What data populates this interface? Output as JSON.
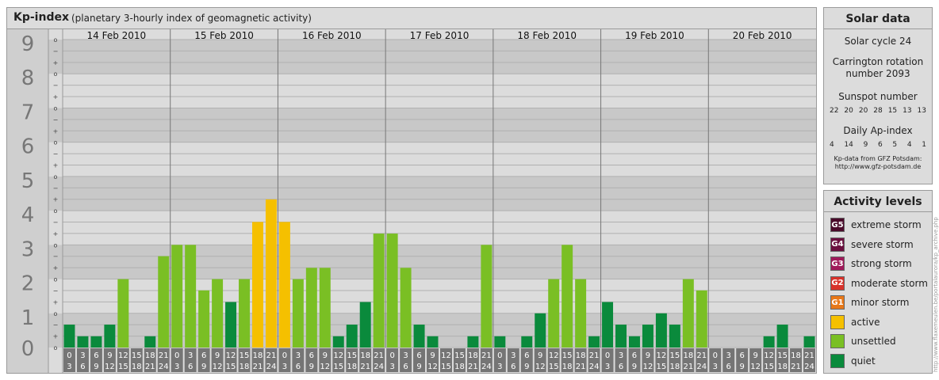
{
  "header": {
    "title": "Kp-index",
    "subtitle": "(planetary 3-hourly index of geomagnetic activity)"
  },
  "chart_data": {
    "type": "bar",
    "title": "Kp-index",
    "subtitle": "(planetary 3-hourly index of geomagnetic activity)",
    "ylim": [
      0,
      9
    ],
    "y_ticks": [
      "0",
      "1",
      "2",
      "3",
      "4",
      "5",
      "6",
      "7",
      "8",
      "9"
    ],
    "y_subticks": [
      "o",
      "+",
      "−"
    ],
    "days": [
      "14 Feb 2010",
      "15 Feb 2010",
      "16 Feb 2010",
      "17 Feb 2010",
      "18 Feb 2010",
      "19 Feb 2010",
      "20 Feb 2010"
    ],
    "interval_labels": [
      [
        "0",
        "3"
      ],
      [
        "3",
        "6"
      ],
      [
        "6",
        "9"
      ],
      [
        "9",
        "12"
      ],
      [
        "12",
        "15"
      ],
      [
        "15",
        "18"
      ],
      [
        "18",
        "21"
      ],
      [
        "21",
        "24"
      ]
    ],
    "kp_values": [
      [
        0.67,
        0.33,
        0.33,
        0.67,
        2.0,
        0.0,
        0.33,
        2.67
      ],
      [
        3.0,
        3.0,
        1.67,
        2.0,
        1.33,
        2.0,
        3.67,
        4.33
      ],
      [
        3.67,
        2.0,
        2.33,
        2.33,
        0.33,
        0.67,
        1.33,
        3.33
      ],
      [
        3.33,
        2.33,
        0.67,
        0.33,
        0.0,
        0.0,
        0.33,
        3.0
      ],
      [
        0.33,
        0.0,
        0.33,
        1.0,
        2.0,
        3.0,
        2.0,
        0.33
      ],
      [
        1.33,
        0.67,
        0.33,
        0.67,
        1.0,
        0.67,
        2.0,
        1.67
      ],
      [
        0.0,
        0.0,
        0.0,
        0.0,
        0.33,
        0.67,
        0.0,
        0.33
      ]
    ],
    "grid": true
  },
  "solar": {
    "title": "Solar data",
    "cycle": "Solar cycle 24",
    "carrington_line1": "Carrington rotation",
    "carrington_line2": "number 2093",
    "sunspot_title": "Sunspot number",
    "sunspot_values": [
      "22",
      "20",
      "20",
      "28",
      "15",
      "13",
      "13"
    ],
    "ap_title": "Daily Ap-index",
    "ap_values": [
      "4",
      "14",
      "9",
      "6",
      "5",
      "4",
      "1"
    ],
    "source_line1": "Kp-data from GFZ Potsdam:",
    "source_line2": "http://www.gfz-potsdam.de"
  },
  "activity": {
    "title": "Activity levels",
    "levels": [
      {
        "code": "G5",
        "label": "extreme storm",
        "color": "#4a0a2a"
      },
      {
        "code": "G4",
        "label": "severe storm",
        "color": "#6b0f3f"
      },
      {
        "code": "G3",
        "label": "strong storm",
        "color": "#a01a5a"
      },
      {
        "code": "G2",
        "label": "moderate storm",
        "color": "#d8322a"
      },
      {
        "code": "G1",
        "label": "minor storm",
        "color": "#e87818"
      },
      {
        "code": "",
        "label": "active",
        "color": "#f5c000"
      },
      {
        "code": "",
        "label": "unsettled",
        "color": "#7abf24"
      },
      {
        "code": "",
        "label": "quiet",
        "color": "#0a8a3c"
      }
    ]
  },
  "watermark": "http://www.flaxemeulen.be/portalaurora/kp_archive.php",
  "colors": {
    "band_dark": "#c8c8c8",
    "band_light": "#dcdcdc",
    "tick_box": "#757575"
  }
}
